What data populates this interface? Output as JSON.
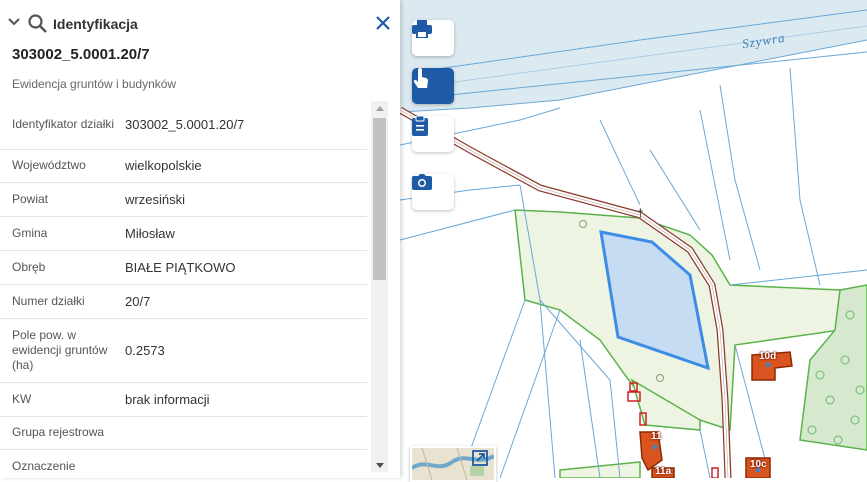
{
  "panel": {
    "title": "Identyfikacja",
    "parcel_id": "303002_5.0001.20/7",
    "subtitle": "Ewidencja gruntów i budynków",
    "rows": [
      {
        "key": "Identyfikator działki",
        "value": "303002_5.0001.20/7"
      },
      {
        "key": "Województwo",
        "value": "wielkopolskie"
      },
      {
        "key": "Powiat",
        "value": "wrzesiński"
      },
      {
        "key": "Gmina",
        "value": "Miłosław"
      },
      {
        "key": "Obręb",
        "value": "BIAŁE PIĄTKOWO"
      },
      {
        "key": "Numer działki",
        "value": "20/7"
      },
      {
        "key": "Pole pow. w ewidencji gruntów (ha)",
        "value": "0.2573"
      },
      {
        "key": "KW",
        "value": "brak informacji"
      },
      {
        "key": "Grupa rejestrowa",
        "value": ""
      },
      {
        "key": "Oznaczenie",
        "value": ""
      }
    ]
  },
  "map": {
    "river_label": "Szywra",
    "building_labels": [
      "10d",
      "11",
      "11a",
      "10c"
    ],
    "tools": [
      "print-icon",
      "identify-hand-icon",
      "clipboard-icon",
      "camera-icon"
    ]
  },
  "colors": {
    "accent": "#1e5aa6",
    "parcel_fill": "#c5dcf2",
    "parcel_stroke": "#3d8ce6",
    "river": "#dbe9f0",
    "field": "#eef4e2",
    "forest": "#d6e9cf",
    "building": "#d9541e"
  }
}
